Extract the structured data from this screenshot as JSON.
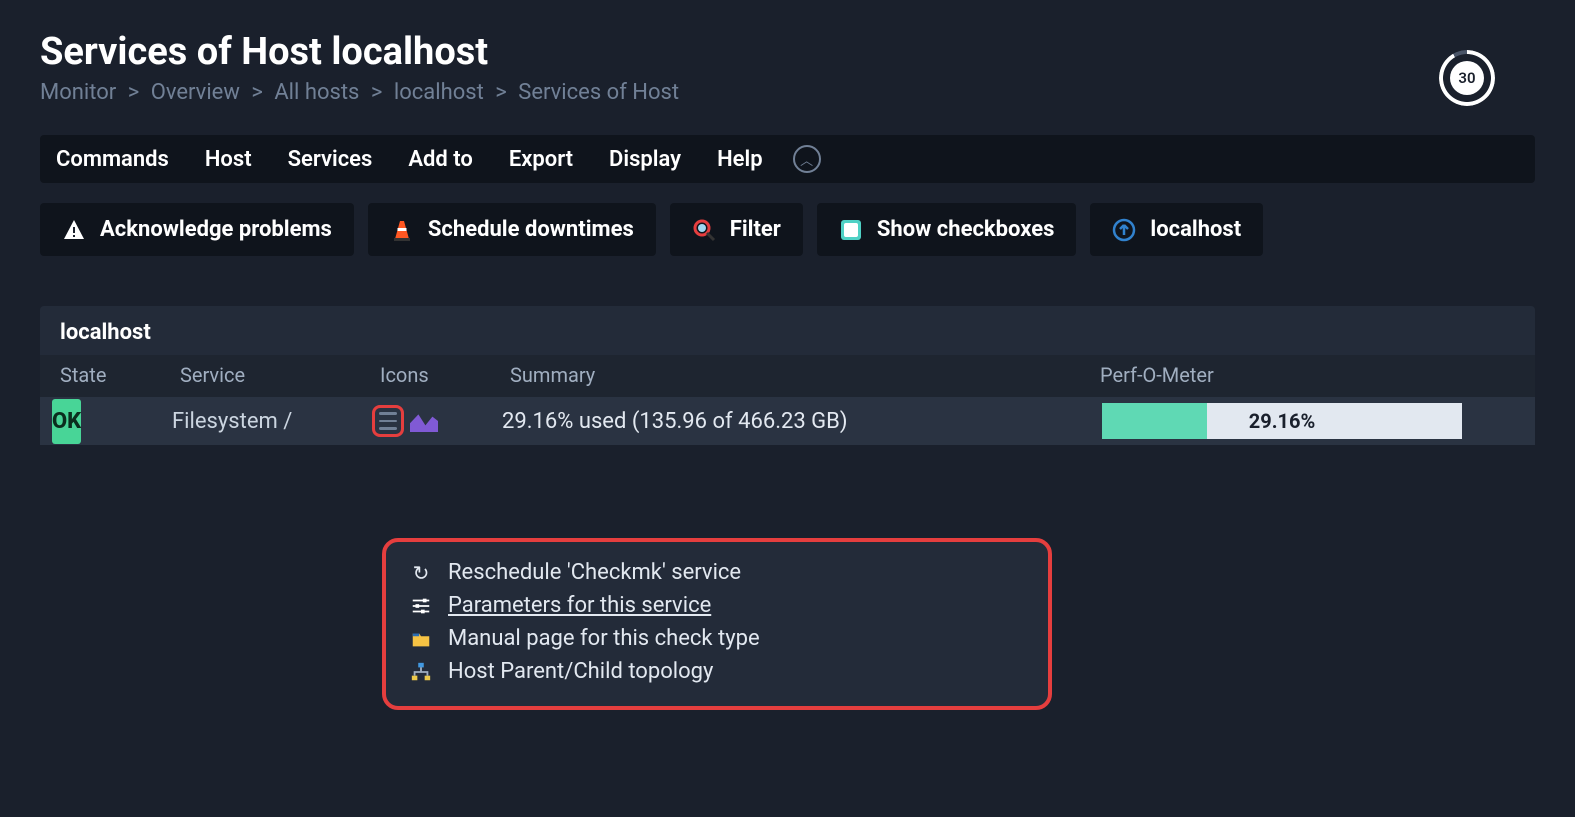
{
  "header": {
    "title": "Services of Host localhost",
    "refresh_seconds": "30"
  },
  "breadcrumb": [
    "Monitor",
    "Overview",
    "All hosts",
    "localhost",
    "Services of Host"
  ],
  "menubar": [
    "Commands",
    "Host",
    "Services",
    "Add to",
    "Export",
    "Display",
    "Help"
  ],
  "toolbar": {
    "ack": "Acknowledge problems",
    "downtime": "Schedule downtimes",
    "filter": "Filter",
    "checkboxes": "Show checkboxes",
    "hostlink": "localhost"
  },
  "panel": {
    "host": "localhost",
    "columns": {
      "state": "State",
      "service": "Service",
      "icons": "Icons",
      "summary": "Summary",
      "perf": "Perf-O-Meter"
    },
    "row": {
      "state": "OK",
      "service": "Filesystem /",
      "summary": "29.16% used (135.96 of 466.23 GB)",
      "perf_percent": 29.16,
      "perf_label": "29.16%"
    }
  },
  "popup": {
    "reschedule": "Reschedule 'Checkmk' service",
    "parameters": "Parameters for this service",
    "manual": "Manual page for this check type",
    "topology": "Host Parent/Child topology"
  }
}
